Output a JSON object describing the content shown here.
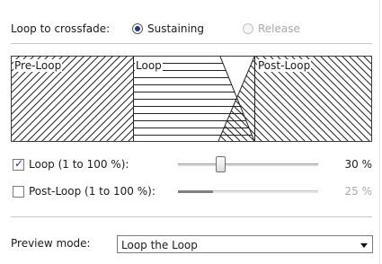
{
  "crossfade": {
    "label": "Loop to crossfade:",
    "options": [
      {
        "label": "Sustaining",
        "selected": true,
        "enabled": true
      },
      {
        "label": "Release",
        "selected": false,
        "enabled": false
      }
    ]
  },
  "diagram": {
    "segments": [
      "Pre-Loop",
      "Loop",
      "Post-Loop"
    ]
  },
  "sliders": [
    {
      "label": "Loop (1 to 100 %):",
      "checked": true,
      "enabled": true,
      "value_text": "30 %",
      "value": 0.3
    },
    {
      "label": "Post-Loop (1 to 100 %):",
      "checked": false,
      "enabled": false,
      "value_text": "25 %",
      "value": 0.25
    }
  ],
  "preview": {
    "label": "Preview mode:",
    "value": "Loop the Loop"
  },
  "colors": {
    "accent": "#1d3a8a",
    "disabled_text": "#a8a8a8",
    "separator": "#c8c8c8"
  }
}
